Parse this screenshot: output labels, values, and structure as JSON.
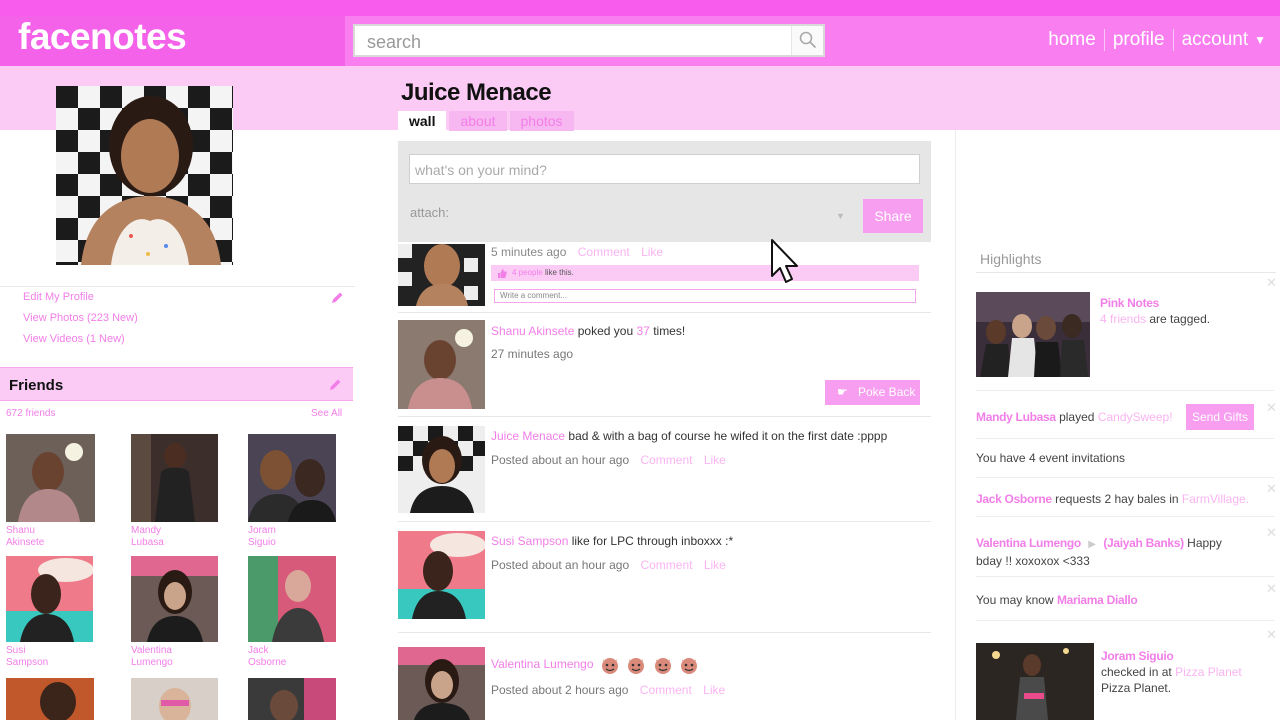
{
  "header": {
    "logo": "facenotes",
    "search_placeholder": "search",
    "nav": {
      "home": "home",
      "profile": "profile",
      "account": "account"
    }
  },
  "profile": {
    "name": "Juice Menace",
    "tabs": [
      {
        "label": "wall",
        "active": true
      },
      {
        "label": "about",
        "active": false
      },
      {
        "label": "photos",
        "active": false
      }
    ],
    "links": {
      "edit": "Edit My Profile",
      "photos": "View Photos (223 New)",
      "videos": "View Videos (1 New)"
    }
  },
  "friends": {
    "title": "Friends",
    "count": "672 friends",
    "see_all": "See All",
    "list": [
      {
        "line1": "Shanu",
        "line2": "Akinsete"
      },
      {
        "line1": "Mandy",
        "line2": "Lubasa"
      },
      {
        "line1": "Joram",
        "line2": "Siguio"
      },
      {
        "line1": "Susi",
        "line2": "Sampson"
      },
      {
        "line1": "Valentina",
        "line2": "Lumengo"
      },
      {
        "line1": "Jack",
        "line2": "Osborne"
      }
    ]
  },
  "composer": {
    "placeholder": "what's on your mind?",
    "attach_label": "attach:",
    "share_label": "Share"
  },
  "feed": {
    "post0": {
      "time": "5 minutes ago",
      "comment": "Comment",
      "like": "Like",
      "likes_text": "4 people",
      "likes_suffix": "like this.",
      "comment_placeholder": "Write a comment..."
    },
    "post1": {
      "name": "Shanu Akinsete",
      "text_a": "poked you",
      "count": "37",
      "text_b": "times!",
      "time": "27 minutes ago",
      "poke_back": "Poke Back"
    },
    "post2": {
      "name": "Juice Menace",
      "text": "bad & with a bag of course he wifed it on the first date :pppp",
      "time": "Posted about an hour ago",
      "comment": "Comment",
      "like": "Like"
    },
    "post3": {
      "name": "Susi Sampson",
      "text": "like for LPC through inboxxx :*",
      "time": "Posted about an hour ago",
      "comment": "Comment",
      "like": "Like"
    },
    "post4": {
      "name": "Valentina Lumengo",
      "time": "Posted about 2 hours ago",
      "comment": "Comment",
      "like": "Like"
    }
  },
  "highlights": {
    "title": "Highlights",
    "pink_notes": {
      "name": "Pink Notes",
      "friends": "4 friends",
      "suffix": "are tagged."
    },
    "candy": {
      "name": "Mandy Lubasa",
      "played": "played",
      "game": "CandySweep!",
      "button": "Send Gifts"
    },
    "events": "You have 4 event invitations",
    "hay": {
      "name": "Jack Osborne",
      "text": "requests 2 hay bales in",
      "game": "FarmVillage."
    },
    "bday": {
      "name": "Valentina Lumengo",
      "target": "(Jaiyah Banks)",
      "text1": "Happy",
      "text2": "bday !! xoxoxox <333"
    },
    "know": {
      "text": "You may know",
      "name": "Mariama Diallo"
    },
    "checkin": {
      "name": "Joram Siguio",
      "text": "checked in at",
      "place": "Pizza Planet",
      "place2": "Pizza Planet."
    }
  },
  "colors": {
    "brand": "#f97ef0",
    "brand_dark": "#f562ea",
    "band": "#fbcbf6",
    "link": "#f27ee8",
    "button": "#f79ef0"
  }
}
